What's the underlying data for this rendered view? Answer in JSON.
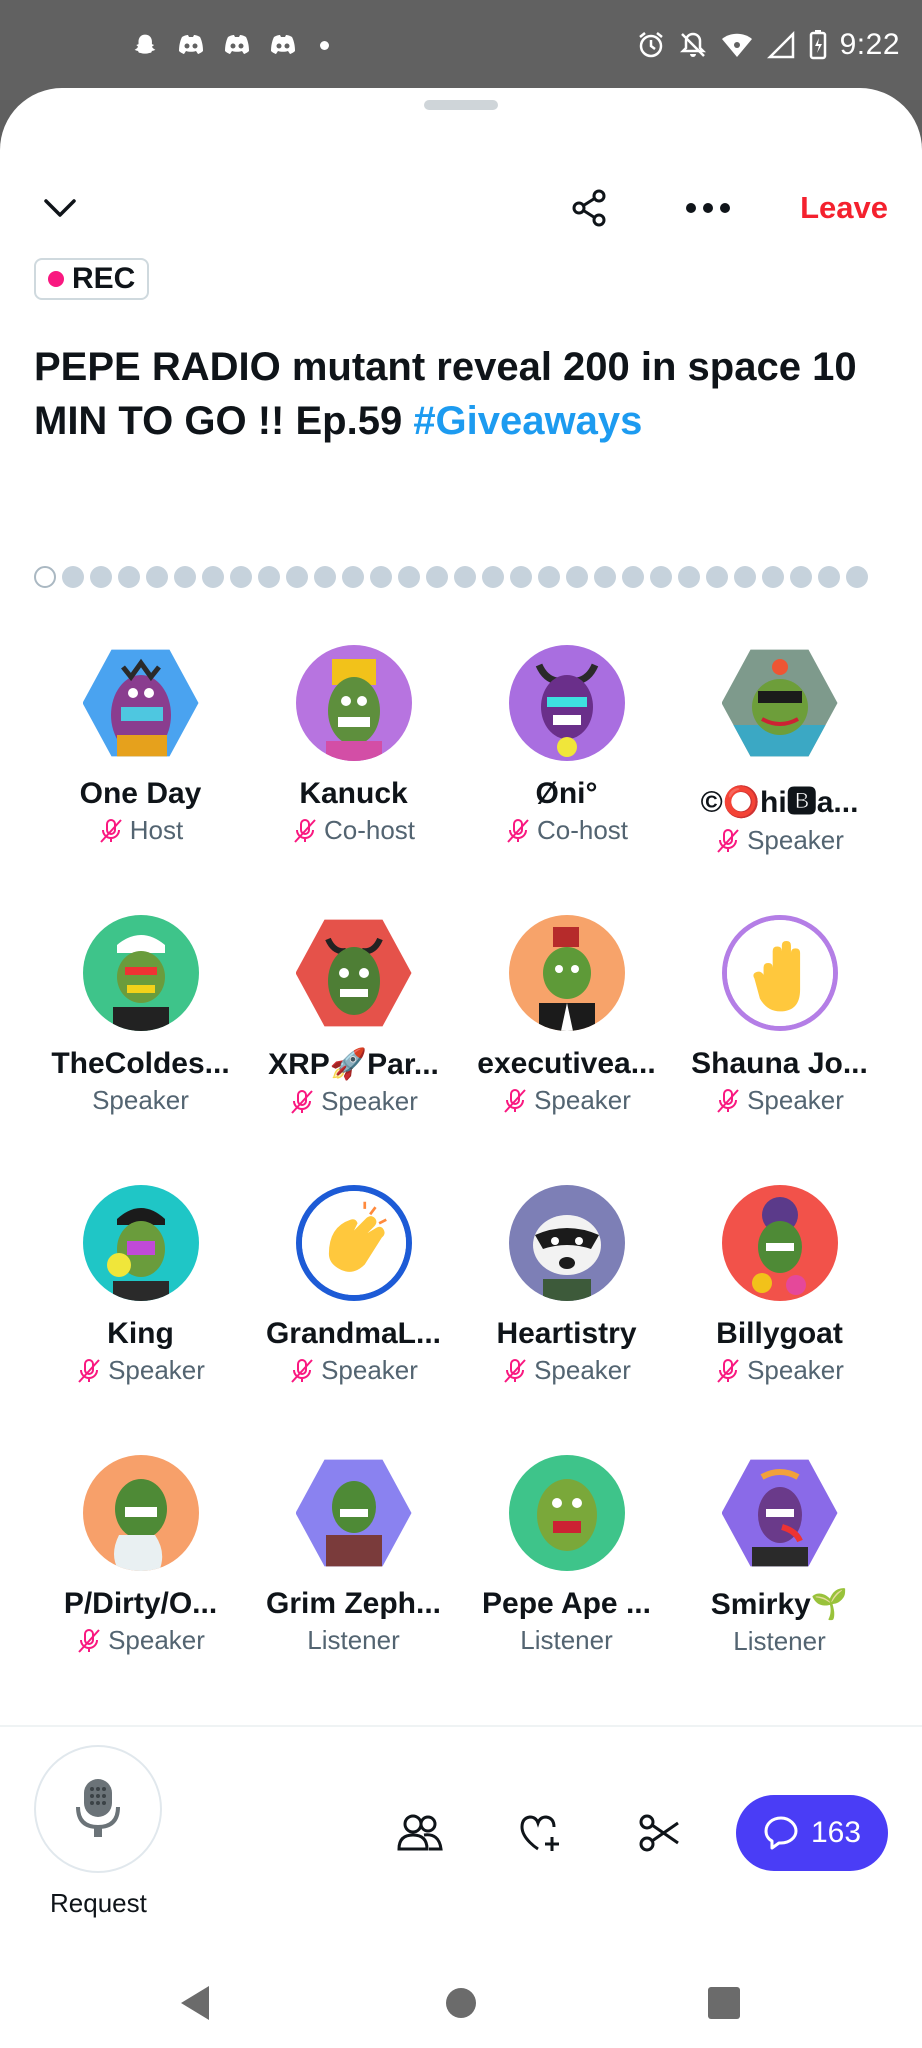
{
  "status_bar": {
    "time": "9:22",
    "left_icons": [
      "snapchat-icon",
      "discord-icon",
      "discord-icon",
      "discord-icon",
      "dot-icon"
    ],
    "right_icons": [
      "alarm-icon",
      "notifications-off-icon",
      "wifi-icon",
      "signal-icon",
      "battery-icon"
    ]
  },
  "header": {
    "collapse_icon": "chevron-down-icon",
    "share_icon": "share-icon",
    "more_icon": "more-icon",
    "leave_label": "Leave"
  },
  "rec_badge": {
    "label": "REC"
  },
  "space": {
    "title": "PEPE RADIO mutant reveal 200 in space 10 MIN TO GO !! Ep.59",
    "hashtag": "#Giveaways"
  },
  "pager": {
    "pages": 30,
    "active": 1
  },
  "participants": [
    {
      "name": "One Day",
      "role": "Host",
      "muted": true
    },
    {
      "name": "Kanuck",
      "role": "Co-host",
      "muted": true
    },
    {
      "name": "Øni°",
      "role": "Co-host",
      "muted": true
    },
    {
      "name": "©⭕hi🅱a...",
      "role": "Speaker",
      "muted": true
    },
    {
      "name": "TheColdes...",
      "role": "Speaker",
      "muted": false
    },
    {
      "name": "XRP🚀Par...",
      "role": "Speaker",
      "muted": true
    },
    {
      "name": "executivea...",
      "role": "Speaker",
      "muted": true
    },
    {
      "name": "Shauna Jo...",
      "role": "Speaker",
      "muted": true
    },
    {
      "name": "King",
      "role": "Speaker",
      "muted": true
    },
    {
      "name": "GrandmaL...",
      "role": "Speaker",
      "muted": true
    },
    {
      "name": "Heartistry",
      "role": "Speaker",
      "muted": true
    },
    {
      "name": "Billygoat",
      "role": "Speaker",
      "muted": true
    },
    {
      "name": "P/Dirty/O...",
      "role": "Speaker",
      "muted": true
    },
    {
      "name": "Grim Zeph...",
      "role": "Listener",
      "muted": false
    },
    {
      "name": "Pepe Ape ...",
      "role": "Listener",
      "muted": false
    },
    {
      "name": "Smirky🌱",
      "role": "Listener",
      "muted": false
    }
  ],
  "bottom_bar": {
    "request_label": "Request",
    "icons": [
      "people-icon",
      "heart-plus-icon",
      "clip-icon"
    ],
    "chat_count": "163"
  },
  "colors": {
    "accent": "#1d9bf0",
    "leave": "#f4212e",
    "rec_dot": "#f91880",
    "chat_button": "#4a3df6",
    "mute_icon": "#f91880"
  }
}
